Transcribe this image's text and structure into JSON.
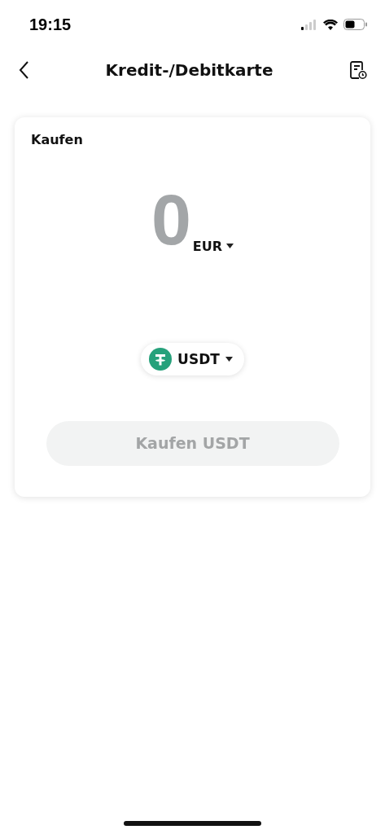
{
  "status_bar": {
    "time": "19:15"
  },
  "header": {
    "title": "Kredit-/Debitkarte"
  },
  "card": {
    "title": "Kaufen",
    "amount": "0",
    "currency": "EUR",
    "coin": "USDT",
    "button": {
      "label": "Kaufen USDT",
      "disabled": true
    }
  }
}
